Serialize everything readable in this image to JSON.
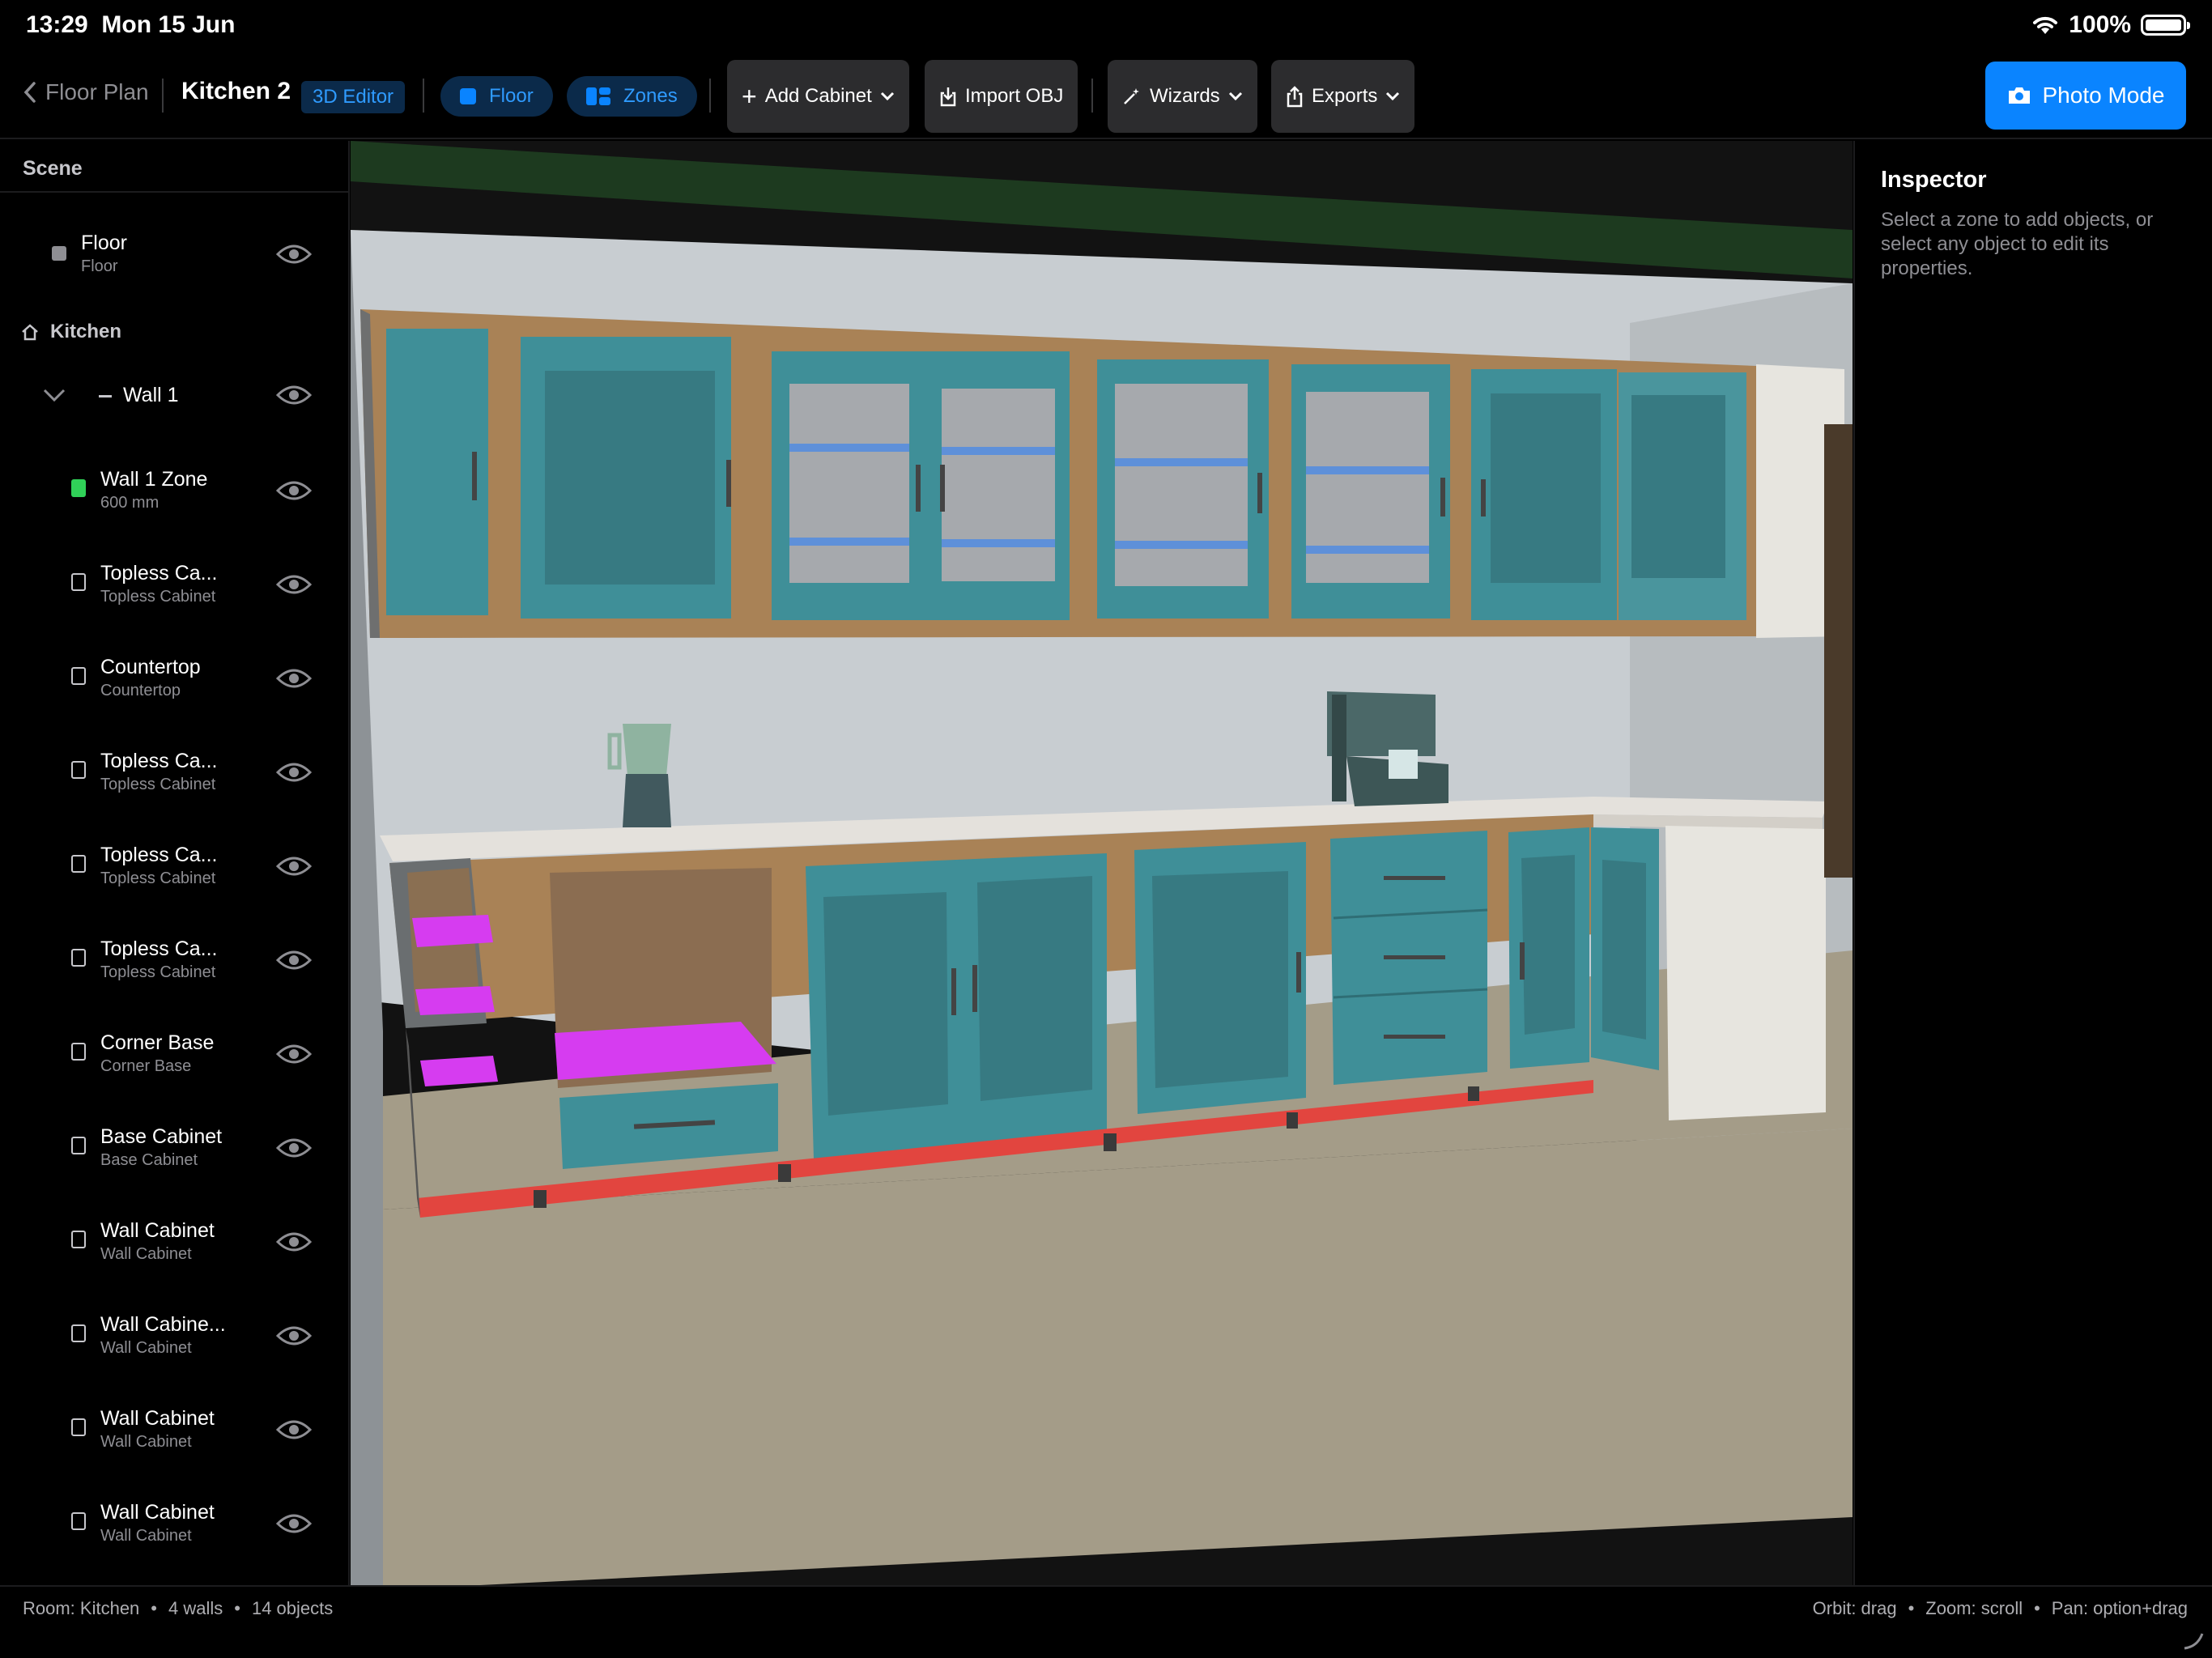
{
  "status_bar": {
    "time": "13:29",
    "date": "Mon 15 Jun",
    "battery": "100%"
  },
  "toolbar": {
    "back_label": "Floor Plan",
    "title": "Kitchen 2",
    "mode_badge": "3D Editor",
    "floor_pill": "Floor",
    "zones_pill": "Zones",
    "add_cabinet": "Add Cabinet",
    "import_obj": "Import OBJ",
    "wizards": "Wizards",
    "exports": "Exports",
    "photo_mode": "Photo Mode"
  },
  "sidebar": {
    "header": "Scene",
    "section_kitchen": "Kitchen",
    "floor": {
      "name": "Floor",
      "sub": "Floor"
    },
    "wall1": {
      "name": "Wall 1"
    },
    "items": [
      {
        "name": "Wall 1 Zone",
        "sub": "600 mm",
        "icon": "zone-icon"
      },
      {
        "name": "Topless Ca...",
        "sub": "Topless Cabinet",
        "icon": "cabinet-icon"
      },
      {
        "name": "Countertop",
        "sub": "Countertop",
        "icon": "countertop-icon"
      },
      {
        "name": "Topless Ca...",
        "sub": "Topless Cabinet",
        "icon": "cabinet-icon"
      },
      {
        "name": "Topless Ca...",
        "sub": "Topless Cabinet",
        "icon": "cabinet-icon"
      },
      {
        "name": "Topless Ca...",
        "sub": "Topless Cabinet",
        "icon": "cabinet-icon"
      },
      {
        "name": "Corner Base",
        "sub": "Corner Base",
        "icon": "corner-base-icon"
      },
      {
        "name": "Base Cabinet",
        "sub": "Base Cabinet",
        "icon": "base-cabinet-icon"
      },
      {
        "name": "Wall Cabinet",
        "sub": "Wall Cabinet",
        "icon": "wall-cabinet-icon"
      },
      {
        "name": "Wall Cabine...",
        "sub": "Wall Cabinet",
        "icon": "wall-cabinet-icon"
      },
      {
        "name": "Wall Cabinet",
        "sub": "Wall Cabinet",
        "icon": "wall-cabinet-icon"
      },
      {
        "name": "Wall Cabinet",
        "sub": "Wall Cabinet",
        "icon": "wall-cabinet-icon"
      }
    ]
  },
  "inspector": {
    "title": "Inspector",
    "text": "Select a zone to add objects, or select any object to edit its properties."
  },
  "footer": {
    "room": "Room: Kitchen",
    "walls": "4 walls",
    "objects": "14 objects",
    "orbit": "Orbit: drag",
    "zoom": "Zoom: scroll",
    "pan": "Pan: option+drag"
  },
  "colors": {
    "accent": "#0a84ff",
    "cabinet_door": "#3f8f98",
    "cabinet_frame": "#a98256",
    "shelf_highlight": "#d63cf0",
    "plinth_highlight": "#e2453f",
    "zone_green": "#30d158"
  }
}
